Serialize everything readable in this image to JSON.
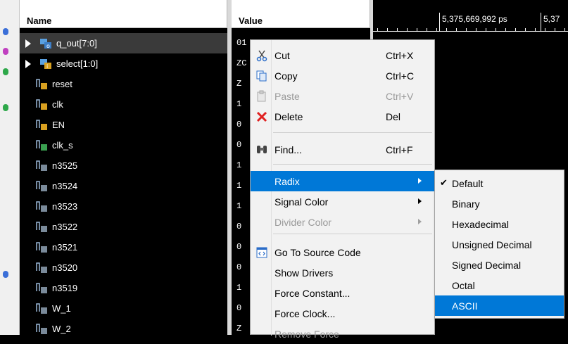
{
  "columns": {
    "name": "Name",
    "value": "Value"
  },
  "signals": [
    {
      "name": "q_out[7:0]",
      "value": "01",
      "expandable": true,
      "icon": "bus-icon",
      "selected": true
    },
    {
      "name": "select[1:0]",
      "value": "ZC",
      "expandable": true,
      "icon": "bus-input-icon",
      "selected": false
    },
    {
      "name": "reset",
      "value": "Z",
      "expandable": false,
      "icon": "input-signal-icon",
      "selected": false
    },
    {
      "name": "clk",
      "value": "1",
      "expandable": false,
      "icon": "input-signal-icon",
      "selected": false
    },
    {
      "name": "EN",
      "value": "0",
      "expandable": false,
      "icon": "input-signal-icon",
      "selected": false
    },
    {
      "name": "clk_s",
      "value": "0",
      "expandable": false,
      "icon": "internal-signal-icon",
      "selected": false
    },
    {
      "name": "n3525",
      "value": "1",
      "expandable": false,
      "icon": "net-signal-icon",
      "selected": false
    },
    {
      "name": "n3524",
      "value": "1",
      "expandable": false,
      "icon": "net-signal-icon",
      "selected": false
    },
    {
      "name": "n3523",
      "value": "1",
      "expandable": false,
      "icon": "net-signal-icon",
      "selected": false
    },
    {
      "name": "n3522",
      "value": "0",
      "expandable": false,
      "icon": "net-signal-icon",
      "selected": false
    },
    {
      "name": "n3521",
      "value": "0",
      "expandable": false,
      "icon": "net-signal-icon",
      "selected": false
    },
    {
      "name": "n3520",
      "value": "0",
      "expandable": false,
      "icon": "net-signal-icon",
      "selected": false
    },
    {
      "name": "n3519",
      "value": "1",
      "expandable": false,
      "icon": "net-signal-icon",
      "selected": false
    },
    {
      "name": "W_1",
      "value": "0",
      "expandable": false,
      "icon": "net-signal-icon",
      "selected": false
    },
    {
      "name": "W_2",
      "value": "Z",
      "expandable": false,
      "icon": "net-signal-icon",
      "selected": false
    }
  ],
  "ruler": {
    "label1": "5,375,669,992 ps",
    "label2": "5,37"
  },
  "context_menu": {
    "items": [
      {
        "label": "Cut",
        "shortcut": "Ctrl+X",
        "icon": "scissors-icon"
      },
      {
        "label": "Copy",
        "shortcut": "Ctrl+C",
        "icon": "copy-icon"
      },
      {
        "label": "Paste",
        "shortcut": "Ctrl+V",
        "icon": "paste-icon",
        "disabled": true
      },
      {
        "label": "Delete",
        "shortcut": "Del",
        "icon": "delete-x-icon"
      },
      {
        "label": "Find...",
        "shortcut": "Ctrl+F",
        "icon": "binoculars-icon"
      },
      {
        "label": "Radix",
        "submenu": true,
        "highlighted": true
      },
      {
        "label": "Signal Color",
        "submenu": true
      },
      {
        "label": "Divider Color",
        "submenu": true,
        "disabled": true
      },
      {
        "label": "Go To Source Code",
        "icon": "source-code-icon"
      },
      {
        "label": "Show Drivers"
      },
      {
        "label": "Force Constant..."
      },
      {
        "label": "Force Clock..."
      },
      {
        "label": "Remove Force",
        "disabled": true
      }
    ]
  },
  "radix_submenu": {
    "items": [
      {
        "label": "Default",
        "checked": true
      },
      {
        "label": "Binary"
      },
      {
        "label": "Hexadecimal"
      },
      {
        "label": "Unsigned Decimal"
      },
      {
        "label": "Signed Decimal"
      },
      {
        "label": "Octal"
      },
      {
        "label": "ASCII",
        "highlighted": true
      }
    ]
  },
  "colors": {
    "menu_highlight": "#0078d7",
    "background": "#000000",
    "menu_bg": "#f2f2f2"
  }
}
